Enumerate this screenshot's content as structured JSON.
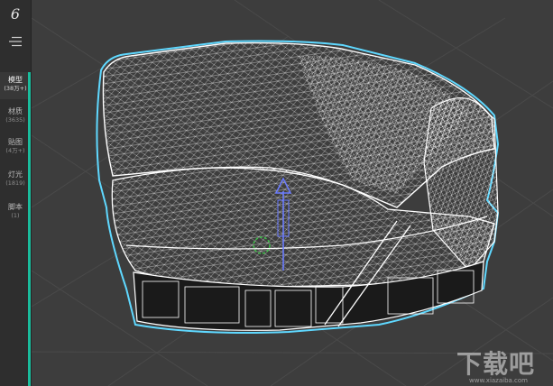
{
  "app": {
    "logo_glyph": "6"
  },
  "sidebar": {
    "items": [
      {
        "label": "模型",
        "count": "(38万+)",
        "active": true
      },
      {
        "label": "材质",
        "count": "(3635)",
        "active": false
      },
      {
        "label": "贴图",
        "count": "(4万+)",
        "active": false
      },
      {
        "label": "灯光",
        "count": "(1819)",
        "active": false
      },
      {
        "label": "脚本",
        "count": "(1)",
        "active": false
      }
    ]
  },
  "colors": {
    "sidebar_bg": "#2e2e2e",
    "viewport_bg": "#3d3d3d",
    "accent": "#1abc9c",
    "wireframe": "#ffffff",
    "selection_outline": "#5fd8ff",
    "gizmo_y": "#6b7cff",
    "gizmo_rot": "#3fbf4a"
  },
  "watermark": {
    "text": "下载吧",
    "url": "www.xiazaiba.com"
  }
}
